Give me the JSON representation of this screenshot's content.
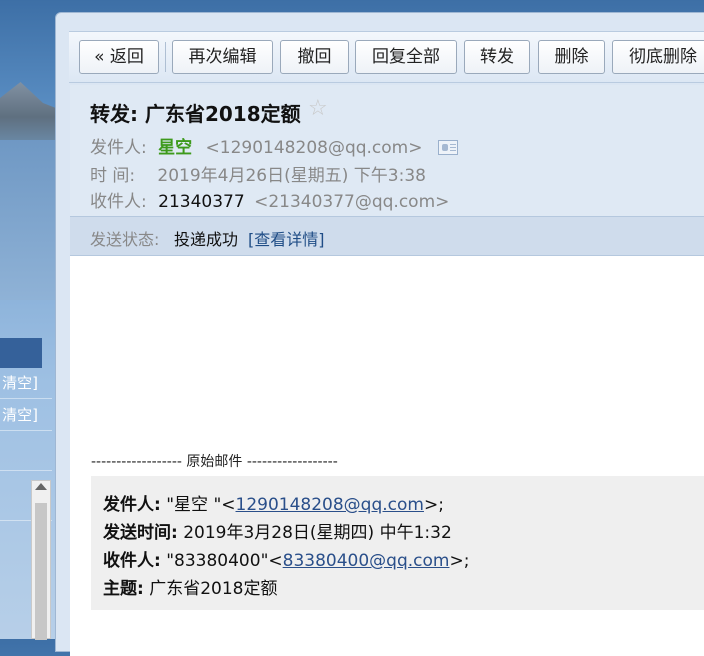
{
  "left_sidebar": {
    "clear_links": [
      "清空]",
      "清空]"
    ]
  },
  "toolbar": {
    "back": "« 返回",
    "reedit": "再次编辑",
    "recall": "撤回",
    "reply_all": "回复全部",
    "forward": "转发",
    "delete": "删除",
    "delete_permanently": "彻底删除"
  },
  "header": {
    "subject": "转发: 广东省2018定额",
    "star_icon": "☆",
    "from_label": "发件人:",
    "from_name": "星空",
    "from_email": "<1290148208@qq.com>",
    "time_label": "时 间:",
    "time_value": "2019年4月26日(星期五) 下午3:38",
    "to_label": "收件人:",
    "to_name": "21340377",
    "to_email": "<21340377@qq.com>",
    "status_label": "发送状态:",
    "status_value": "投递成功",
    "status_link": "[查看详情]"
  },
  "original": {
    "divider": "------------------ 原始邮件 ------------------",
    "from_label": "发件人:",
    "from_prefix": "\"星空 \"<",
    "from_email": "1290148208@qq.com",
    "from_suffix": ">;",
    "sent_label": "发送时间:",
    "sent_value": "2019年3月28日(星期四) 中午1:32",
    "to_label": "收件人:",
    "to_prefix": "\"83380400\"<",
    "to_email": "83380400@qq.com",
    "to_suffix": ">;",
    "subject_label": "主题:",
    "subject_value": "广东省2018定额"
  },
  "colors": {
    "sender_name": "#3d9a1b",
    "link": "#2a4f8a"
  }
}
